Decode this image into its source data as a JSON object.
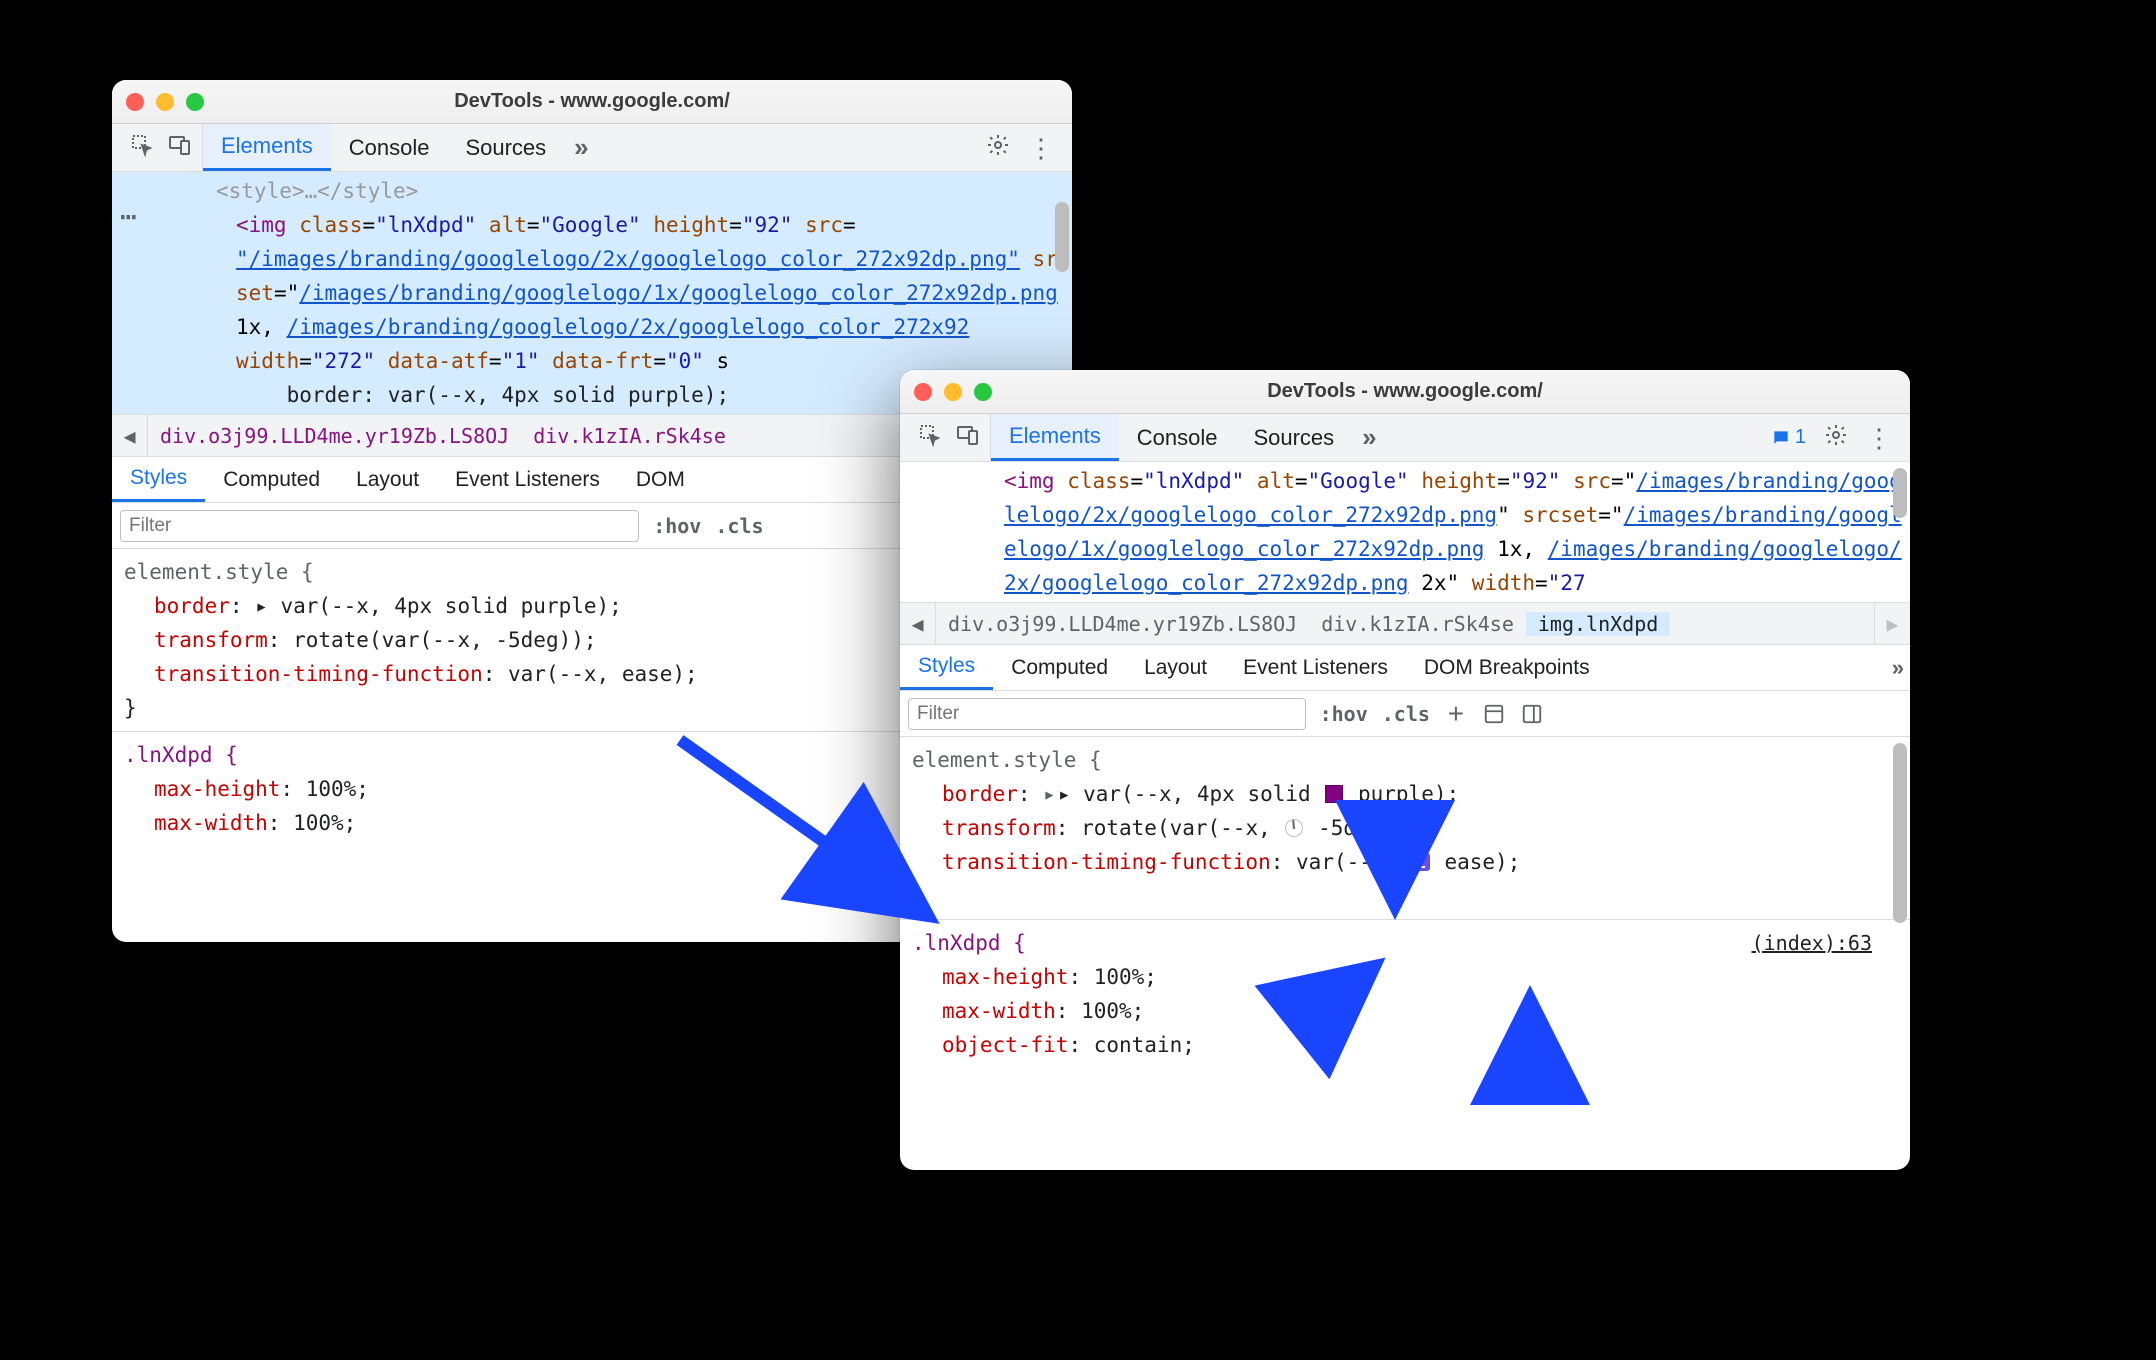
{
  "left": {
    "title": "DevTools - www.google.com/",
    "tabs": {
      "elements": "Elements",
      "console": "Console",
      "sources": "Sources"
    },
    "dom": {
      "ghost": "<style>…</style>",
      "open": "<img class=\"lnXdpd\" alt=\"Google\" height=\"92\" src=",
      "link1": "\"/images/branding/googlelogo/2x/googlelogo_color_272x92dp.png\"",
      "mid1": " srcset=\"",
      "link2": "/images/branding/googlelogo/1x/googlelogo_color_272x92dp.png",
      "mid2": " 1x, ",
      "link3": "/images/branding/googlelogo/2x/googlelogo_color_272x92",
      "tail": "width=\"272\" data-atf=\"1\" data-frt=\"0\" s",
      "tail2": "border: var(--x, 4px solid purple);"
    },
    "breadcrumbs": {
      "a": "div.o3j99.LLD4me.yr19Zb.LS8OJ",
      "b": "div.k1zIA.rSk4se"
    },
    "subtabs": {
      "styles": "Styles",
      "computed": "Computed",
      "layout": "Layout",
      "listeners": "Event Listeners",
      "dom": "DOM "
    },
    "filter": {
      "placeholder": "Filter",
      "hov": ":hov",
      "cls": ".cls"
    },
    "styles": {
      "sel1": "element.style {",
      "d1p": "border",
      "d1v": "▸ var(--x, 4px solid purple);",
      "d2p": "transform",
      "d2v": "rotate(var(--x, -5deg));",
      "d3p": "transition-timing-function",
      "d3v": "var(--x, ease);",
      "close": "}",
      "sel2": ".lnXdpd {",
      "d4p": "max-height",
      "d4v": "100%;",
      "d5p": "max-width",
      "d5v": "100%;"
    }
  },
  "right": {
    "title": "DevTools - www.google.com/",
    "tabs": {
      "elements": "Elements",
      "console": "Console",
      "sources": "Sources"
    },
    "msg_count": "1",
    "dom": {
      "open": "<img class=\"lnXdpd\" alt=\"Google\" height=\"92\" src=\"",
      "link1": "/images/branding/googlelogo/2x/googlelogo_color_272x92dp.png",
      "mid1": "\" srcset=\"",
      "link2": "/images/branding/googlelogo/1x/googlelogo_color_272x92dp.png",
      "mid2": " 1x, ",
      "link3": "/images/branding/googlelogo/2x/googlelogo_color_272x92dp.png",
      "mid3": " 2x\" width=\"27"
    },
    "breadcrumbs": {
      "a": "div.o3j99.LLD4me.yr19Zb.LS8OJ",
      "b": "div.k1zIA.rSk4se",
      "c": "img.lnXdpd"
    },
    "subtabs": {
      "styles": "Styles",
      "computed": "Computed",
      "layout": "Layout",
      "listeners": "Event Listeners",
      "dom": "DOM Breakpoints"
    },
    "filter": {
      "placeholder": "Filter",
      "hov": ":hov",
      "cls": ".cls"
    },
    "styles": {
      "sel1": "element.style {",
      "d1p": "border",
      "d1pre": "▸ var(--x, 4px solid ",
      "d1post": "purple);",
      "d2p": "transform",
      "d2pre": "rotate(var(--x, ",
      "d2post": "-5deg));",
      "d3p": "transition-timing-function",
      "d3pre": "var(--x, ",
      "d3post": "ease);",
      "close": "}",
      "sel2": ".lnXdpd {",
      "index": "(index):63",
      "d4p": "max-height",
      "d4v": "100%;",
      "d5p": "max-width",
      "d5v": "100%;",
      "d6p": "object-fit",
      "d6v": "contain;"
    }
  },
  "colors": {
    "purple": "#800080"
  }
}
